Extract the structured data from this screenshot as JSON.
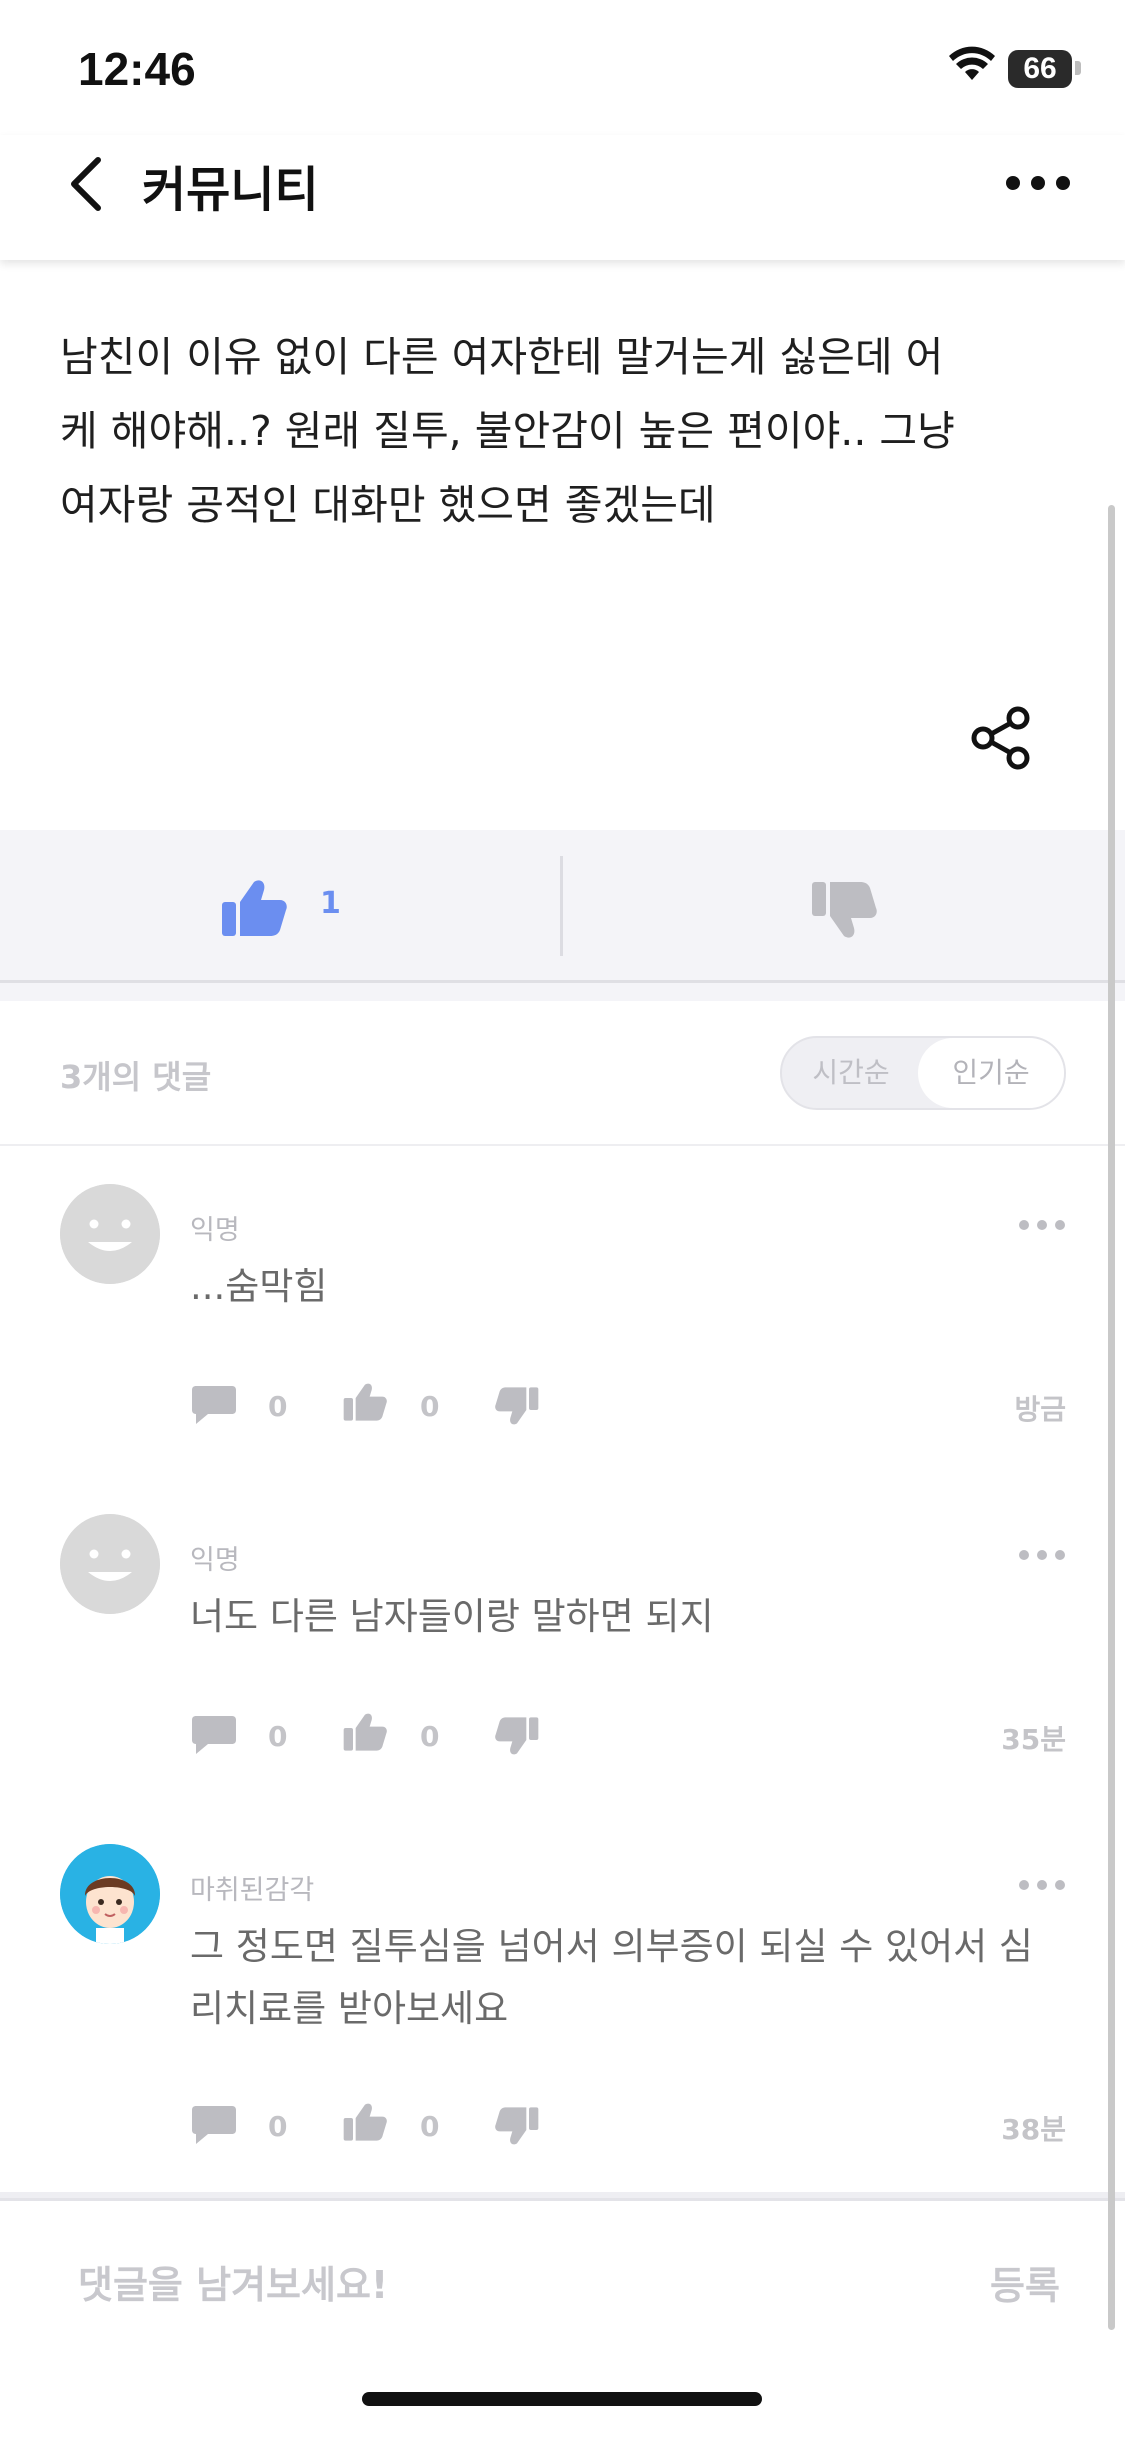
{
  "status_bar": {
    "time": "12:46",
    "battery": "66"
  },
  "header": {
    "title": "커뮤니티"
  },
  "post": {
    "lines": [
      "남친이 이유 없이 다른 여자한테 말거는게 싫은데 어",
      "케 해야해..? 원래 질투, 불안감이 높은 편이야.. 그냥",
      "여자랑 공적인 대화만 했으면 좋겠는데"
    ],
    "likes": "1"
  },
  "comments_header": {
    "count_label": "3개의 댓글",
    "sort_time": "시간순",
    "sort_popular": "인기순"
  },
  "comments": [
    {
      "author": "익명",
      "text_lines": [
        "...숨막힘"
      ],
      "replies": "0",
      "likes": "0",
      "time": "방금"
    },
    {
      "author": "익명",
      "text_lines": [
        "너도 다른 남자들이랑 말하면 되지"
      ],
      "replies": "0",
      "likes": "0",
      "time": "35분"
    },
    {
      "author": "마취된감각",
      "text_lines": [
        "그 정도면 질투심을 넘어서 의부증이 되실 수 있어서 심",
        "리치료를 받아보세요"
      ],
      "replies": "0",
      "likes": "0",
      "time": "38분"
    }
  ],
  "comment_input": {
    "placeholder": "댓글을 남겨보세요!",
    "submit_label": "등록"
  },
  "colors": {
    "accent": "#6b8ef0",
    "muted": "#c4c4c8",
    "icon_gray": "#bdbdc2"
  }
}
